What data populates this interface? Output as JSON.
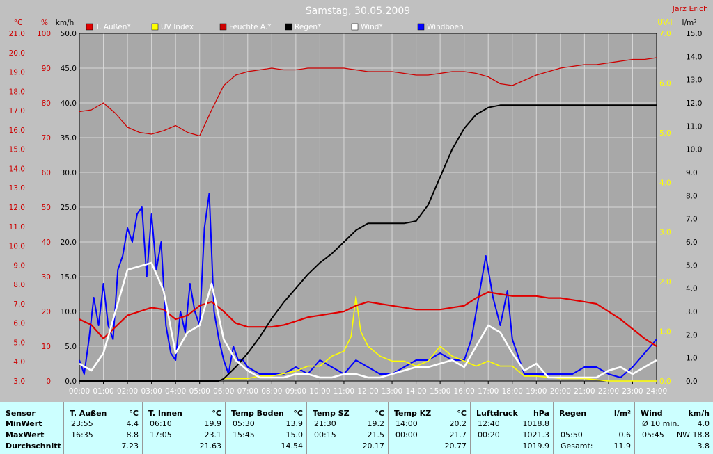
{
  "title": "Samstag, 30.05.2009",
  "author": "Jarz Erich",
  "axes": {
    "left1_unit": "°C",
    "left2_unit": "%",
    "left3_unit": "km/h",
    "right1_unit": "UV-I",
    "right2_unit": "l/m²",
    "left1_ticks": [
      "21.0",
      "20.0",
      "19.0",
      "18.0",
      "17.0",
      "16.0",
      "15.0",
      "14.0",
      "13.0",
      "12.0",
      "11.0",
      "10.0",
      "9.0",
      "8.0",
      "7.0",
      "6.0",
      "5.0",
      "4.0",
      "3.0"
    ],
    "left2_ticks": [
      "100",
      "90",
      "80",
      "70",
      "60",
      "50",
      "40",
      "30",
      "20",
      "10",
      "0"
    ],
    "left3_ticks": [
      "50.0",
      "45.0",
      "40.0",
      "35.0",
      "30.0",
      "25.0",
      "20.0",
      "15.0",
      "10.0",
      "5.0",
      "0.0"
    ],
    "right1_ticks": [
      "7.0",
      "6.0",
      "5.0",
      "4.0",
      "3.0",
      "2.0",
      "1.0",
      "0.0"
    ],
    "right2_ticks": [
      "15.0",
      "14.0",
      "13.0",
      "12.0",
      "11.0",
      "10.0",
      "9.0",
      "8.0",
      "7.0",
      "6.0",
      "5.0",
      "4.0",
      "3.0",
      "2.0",
      "1.0",
      "0.0"
    ],
    "x_ticks": [
      "00:00",
      "01:00",
      "02:00",
      "03:00",
      "04:00",
      "05:00",
      "06:00",
      "07:00",
      "08:00",
      "09:00",
      "10:00",
      "11:00",
      "12:00",
      "13:00",
      "14:00",
      "15:00",
      "16:00",
      "17:00",
      "18:00",
      "19:00",
      "20:00",
      "21:00",
      "22:00",
      "23:00",
      "24:00"
    ]
  },
  "colors": {
    "background": "#c0c0c0",
    "plot": "#a8a8a8",
    "temp": "#e00000",
    "humidity": "#cc0000",
    "uv": "#ffff00",
    "rain": "#000000",
    "wind": "#ffffff",
    "gusts": "#0000ff",
    "left_axis": "#cc0000",
    "right_axis": "#ffff00"
  },
  "chart_data": {
    "type": "line",
    "title": "Samstag, 30.05.2009",
    "xlabel": "",
    "ylabel": "",
    "xlim": [
      0,
      24
    ],
    "grid": true,
    "legend_position": "top",
    "axis_ranges": {
      "temp_C": [
        3,
        21
      ],
      "humidity_pct": [
        0,
        100
      ],
      "wind_kmh": [
        0,
        50
      ],
      "uv_index": [
        0,
        7
      ],
      "rain_lm2": [
        0,
        15
      ]
    },
    "series": [
      {
        "name": "T. Außen*",
        "axis": "temp_C",
        "color": "#e00000",
        "x": [
          0,
          0.5,
          1,
          1.5,
          2,
          2.5,
          3,
          3.5,
          4,
          4.5,
          5,
          5.5,
          6,
          6.5,
          7,
          7.5,
          8,
          8.5,
          9,
          9.5,
          10,
          10.5,
          11,
          11.5,
          12,
          12.5,
          13,
          13.5,
          14,
          14.5,
          15,
          15.5,
          16,
          16.5,
          17,
          17.5,
          18,
          18.5,
          19,
          19.5,
          20,
          20.5,
          21,
          21.5,
          22,
          22.5,
          23,
          23.5,
          24
        ],
        "y": [
          6.2,
          5.9,
          5.2,
          5.8,
          6.4,
          6.6,
          6.8,
          6.7,
          6.2,
          6.4,
          6.9,
          7.1,
          6.6,
          6.0,
          5.8,
          5.8,
          5.8,
          5.9,
          6.1,
          6.3,
          6.4,
          6.5,
          6.6,
          6.9,
          7.1,
          7.0,
          6.9,
          6.8,
          6.7,
          6.7,
          6.7,
          6.8,
          6.9,
          7.3,
          7.6,
          7.5,
          7.4,
          7.4,
          7.4,
          7.3,
          7.3,
          7.2,
          7.1,
          7.0,
          6.6,
          6.2,
          5.7,
          5.2,
          4.8
        ]
      },
      {
        "name": "Feuchte A.*",
        "axis": "humidity_pct",
        "color": "#cc0000",
        "x": [
          0,
          0.5,
          1,
          1.5,
          2,
          2.5,
          3,
          3.5,
          4,
          4.5,
          5,
          5.5,
          6,
          6.5,
          7,
          7.5,
          8,
          8.5,
          9,
          9.5,
          10,
          10.5,
          11,
          11.5,
          12,
          12.5,
          13,
          13.5,
          14,
          14.5,
          15,
          15.5,
          16,
          16.5,
          17,
          17.5,
          18,
          18.5,
          19,
          19.5,
          20,
          20.5,
          21,
          21.5,
          22,
          22.5,
          23,
          23.5,
          24
        ],
        "y": [
          77.5,
          78,
          80,
          77,
          73,
          71.5,
          71,
          72,
          73.5,
          71.5,
          70.5,
          78,
          85,
          88,
          89,
          89.5,
          90,
          89.5,
          89.5,
          90,
          90,
          90,
          90,
          89.5,
          89,
          89,
          89,
          88.5,
          88,
          88,
          88.5,
          89,
          89,
          88.5,
          87.5,
          85.5,
          85,
          86.5,
          88,
          89,
          90,
          90.5,
          91,
          91,
          91.5,
          92,
          92.5,
          92.5,
          93
        ]
      },
      {
        "name": "UV Index",
        "axis": "uv_index",
        "color": "#ffff00",
        "x": [
          0,
          1,
          2,
          3,
          4,
          5,
          5.8,
          6,
          6.5,
          7,
          7.5,
          8,
          8.5,
          9,
          9.5,
          10,
          10.5,
          11,
          11.3,
          11.5,
          11.7,
          12,
          12.5,
          13,
          13.5,
          14,
          14.5,
          15,
          15.5,
          16,
          16.5,
          17,
          17.5,
          18,
          18.5,
          19,
          20,
          21,
          22,
          23,
          24
        ],
        "y": [
          0,
          0,
          0,
          0,
          0,
          0,
          0,
          0.05,
          0.05,
          0.05,
          0.1,
          0.1,
          0.15,
          0.2,
          0.3,
          0.3,
          0.5,
          0.6,
          0.9,
          1.7,
          1.0,
          0.7,
          0.5,
          0.4,
          0.4,
          0.3,
          0.4,
          0.7,
          0.5,
          0.4,
          0.3,
          0.4,
          0.3,
          0.3,
          0.1,
          0.1,
          0.05,
          0.05,
          0,
          0,
          0
        ]
      },
      {
        "name": "Regen*",
        "axis": "rain_lm2",
        "color": "#000000",
        "x": [
          0,
          5.8,
          6,
          6.5,
          7,
          7.5,
          8,
          8.5,
          9,
          9.5,
          10,
          10.5,
          11,
          11.5,
          12,
          12.5,
          13,
          13.5,
          14,
          14.5,
          15,
          15.5,
          16,
          16.5,
          17,
          17.5,
          18,
          18.5,
          19,
          20,
          21,
          22,
          23,
          24
        ],
        "y": [
          0,
          0,
          0.1,
          0.6,
          1.2,
          1.9,
          2.7,
          3.4,
          4.0,
          4.6,
          5.1,
          5.5,
          6.0,
          6.5,
          6.8,
          6.8,
          6.8,
          6.8,
          6.9,
          7.6,
          8.8,
          10.0,
          10.9,
          11.5,
          11.8,
          11.9,
          11.9,
          11.9,
          11.9,
          11.9,
          11.9,
          11.9,
          11.9,
          11.9
        ]
      },
      {
        "name": "Wind*",
        "axis": "wind_kmh",
        "color": "#ffffff",
        "x": [
          0,
          0.5,
          1,
          1.5,
          2,
          2.5,
          3,
          3.5,
          4,
          4.5,
          5,
          5.5,
          6,
          6.5,
          7,
          7.5,
          8,
          8.5,
          9,
          9.5,
          10,
          10.5,
          11,
          11.5,
          12,
          12.5,
          13,
          13.5,
          14,
          14.5,
          15,
          15.5,
          16,
          16.5,
          17,
          17.5,
          18,
          18.5,
          19,
          19.5,
          20,
          20.5,
          21,
          21.5,
          22,
          22.5,
          23,
          23.5,
          24
        ],
        "y": [
          2.5,
          1.5,
          4,
          10,
          16,
          16.5,
          17,
          13,
          4,
          7,
          8,
          14,
          6,
          3,
          1.5,
          0.5,
          0.5,
          0.5,
          1,
          1,
          0.5,
          0.5,
          1,
          1,
          0.5,
          0.5,
          1,
          1.5,
          2,
          2,
          2.5,
          3,
          2,
          5,
          8,
          7,
          4,
          1.5,
          2.5,
          0.5,
          0.5,
          0.5,
          0.5,
          0.5,
          1.5,
          2,
          1,
          2,
          3
        ]
      },
      {
        "name": "Windböen",
        "axis": "wind_kmh",
        "color": "#0000ff",
        "x": [
          0,
          0.2,
          0.4,
          0.6,
          0.8,
          1,
          1.2,
          1.4,
          1.6,
          1.8,
          2,
          2.2,
          2.4,
          2.6,
          2.8,
          3,
          3.2,
          3.4,
          3.6,
          3.8,
          4,
          4.2,
          4.4,
          4.6,
          4.8,
          5,
          5.2,
          5.4,
          5.6,
          5.8,
          6,
          6.2,
          6.4,
          6.6,
          6.8,
          7,
          7.5,
          8,
          8.5,
          9,
          9.5,
          10,
          10.5,
          11,
          11.5,
          12,
          12.5,
          13,
          13.5,
          14,
          14.5,
          15,
          15.5,
          16,
          16.3,
          16.6,
          16.9,
          17.2,
          17.5,
          17.8,
          18,
          18.2,
          18.5,
          19,
          19.5,
          20,
          20.5,
          21,
          21.5,
          22,
          22.5,
          23,
          23.5,
          24
        ],
        "y": [
          3,
          1,
          6,
          12,
          8,
          14,
          8,
          6,
          16,
          18,
          22,
          20,
          24,
          25,
          15,
          24,
          16,
          20,
          8,
          4,
          3,
          10,
          7,
          14,
          10,
          8,
          22,
          27,
          10,
          6,
          3,
          1,
          5,
          3,
          3,
          2,
          1,
          1,
          1,
          2,
          1,
          3,
          2,
          1,
          3,
          2,
          1,
          1,
          2,
          3,
          3,
          4,
          3,
          3,
          6,
          12,
          18,
          12,
          8,
          13,
          6,
          4,
          1,
          1,
          1,
          1,
          1,
          2,
          2,
          1,
          0.5,
          2,
          4,
          6
        ]
      }
    ]
  },
  "legend": [
    {
      "label": "T. Außen*",
      "color": "#e00000"
    },
    {
      "label": "UV Index",
      "color": "#ffff00"
    },
    {
      "label": "Feuchte A.*",
      "color": "#cc0000"
    },
    {
      "label": "Regen*",
      "color": "#000000"
    },
    {
      "label": "Wind*",
      "color": "#ffffff"
    },
    {
      "label": "Windböen",
      "color": "#0000ff"
    }
  ],
  "summary": {
    "sensor": {
      "header": "Sensor",
      "min": "MinWert",
      "max": "MaxWert",
      "avg": "Durchschnitt"
    },
    "t_aussen": {
      "name": "T. Außen",
      "unit": "°C",
      "min_time": "23:55",
      "min_val": "4.4",
      "max_time": "16:35",
      "max_val": "8.8",
      "avg": "7.23"
    },
    "t_innen": {
      "name": "T. Innen",
      "unit": "°C",
      "min_time": "06:10",
      "min_val": "19.9",
      "max_time": "17:05",
      "max_val": "23.1",
      "avg": "21.63"
    },
    "temp_boden": {
      "name": "Temp Boden",
      "unit": "°C",
      "min_time": "05:30",
      "min_val": "13.9",
      "max_time": "15:45",
      "max_val": "15.0",
      "avg": "14.54"
    },
    "temp_sz": {
      "name": "Temp SZ",
      "unit": "°C",
      "min_time": "21:30",
      "min_val": "19.2",
      "max_time": "00:15",
      "max_val": "21.5",
      "avg": "20.17"
    },
    "temp_kz": {
      "name": "Temp KZ",
      "unit": "°C",
      "min_time": "14:00",
      "min_val": "20.2",
      "max_time": "00:00",
      "max_val": "21.7",
      "avg": "20.77"
    },
    "luftdruck": {
      "name": "Luftdruck",
      "unit": "hPa",
      "min_time": "12:40",
      "min_val": "1018.8",
      "max_time": "00:20",
      "max_val": "1021.3",
      "avg": "1019.9"
    },
    "regen": {
      "name": "Regen",
      "unit": "l/m²",
      "max_time": "05:50",
      "max_val": "0.6",
      "total_label": "Gesamt:",
      "total_val": "11.9"
    },
    "wind": {
      "name": "Wind",
      "unit": "km/h",
      "min_label": "Ø 10 min.",
      "min_val": "4.0",
      "max_time": "05:45",
      "max_val": "NW 18.8",
      "avg": "3.8"
    }
  }
}
